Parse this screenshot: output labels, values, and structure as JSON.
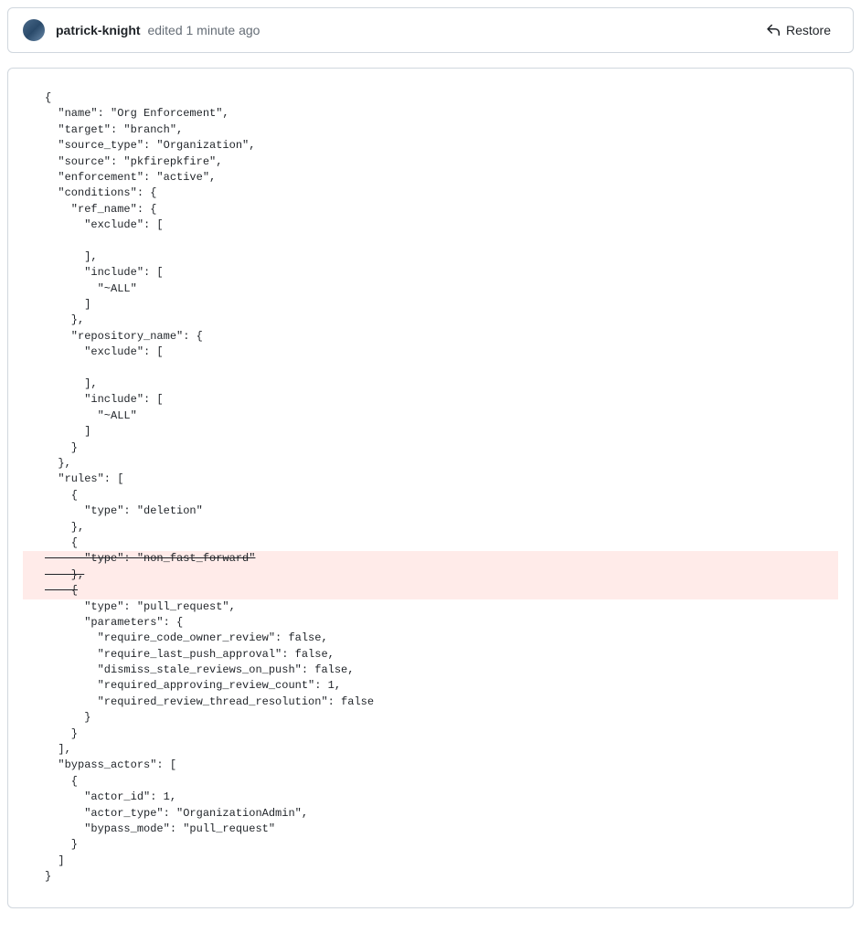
{
  "header": {
    "username": "patrick-knight",
    "edit_info": "edited 1 minute ago",
    "restore_label": "Restore"
  },
  "code": {
    "lines": [
      {
        "text": "{",
        "deleted": false
      },
      {
        "text": "  \"name\": \"Org Enforcement\",",
        "deleted": false
      },
      {
        "text": "  \"target\": \"branch\",",
        "deleted": false
      },
      {
        "text": "  \"source_type\": \"Organization\",",
        "deleted": false
      },
      {
        "text": "  \"source\": \"pkfirepkfire\",",
        "deleted": false
      },
      {
        "text": "  \"enforcement\": \"active\",",
        "deleted": false
      },
      {
        "text": "  \"conditions\": {",
        "deleted": false
      },
      {
        "text": "    \"ref_name\": {",
        "deleted": false
      },
      {
        "text": "      \"exclude\": [",
        "deleted": false
      },
      {
        "text": "",
        "deleted": false
      },
      {
        "text": "      ],",
        "deleted": false
      },
      {
        "text": "      \"include\": [",
        "deleted": false
      },
      {
        "text": "        \"~ALL\"",
        "deleted": false
      },
      {
        "text": "      ]",
        "deleted": false
      },
      {
        "text": "    },",
        "deleted": false
      },
      {
        "text": "    \"repository_name\": {",
        "deleted": false
      },
      {
        "text": "      \"exclude\": [",
        "deleted": false
      },
      {
        "text": "",
        "deleted": false
      },
      {
        "text": "      ],",
        "deleted": false
      },
      {
        "text": "      \"include\": [",
        "deleted": false
      },
      {
        "text": "        \"~ALL\"",
        "deleted": false
      },
      {
        "text": "      ]",
        "deleted": false
      },
      {
        "text": "    }",
        "deleted": false
      },
      {
        "text": "  },",
        "deleted": false
      },
      {
        "text": "  \"rules\": [",
        "deleted": false
      },
      {
        "text": "    {",
        "deleted": false
      },
      {
        "text": "      \"type\": \"deletion\"",
        "deleted": false
      },
      {
        "text": "    },",
        "deleted": false
      },
      {
        "text": "    {",
        "deleted": false
      },
      {
        "text": "      \"type\": \"non_fast_forward\"",
        "deleted": true
      },
      {
        "text": "    },",
        "deleted": true
      },
      {
        "text": "    {",
        "deleted": true
      },
      {
        "text": "      \"type\": \"pull_request\",",
        "deleted": false
      },
      {
        "text": "      \"parameters\": {",
        "deleted": false
      },
      {
        "text": "        \"require_code_owner_review\": false,",
        "deleted": false
      },
      {
        "text": "        \"require_last_push_approval\": false,",
        "deleted": false
      },
      {
        "text": "        \"dismiss_stale_reviews_on_push\": false,",
        "deleted": false
      },
      {
        "text": "        \"required_approving_review_count\": 1,",
        "deleted": false
      },
      {
        "text": "        \"required_review_thread_resolution\": false",
        "deleted": false
      },
      {
        "text": "      }",
        "deleted": false
      },
      {
        "text": "    }",
        "deleted": false
      },
      {
        "text": "  ],",
        "deleted": false
      },
      {
        "text": "  \"bypass_actors\": [",
        "deleted": false
      },
      {
        "text": "    {",
        "deleted": false
      },
      {
        "text": "      \"actor_id\": 1,",
        "deleted": false
      },
      {
        "text": "      \"actor_type\": \"OrganizationAdmin\",",
        "deleted": false
      },
      {
        "text": "      \"bypass_mode\": \"pull_request\"",
        "deleted": false
      },
      {
        "text": "    }",
        "deleted": false
      },
      {
        "text": "  ]",
        "deleted": false
      },
      {
        "text": "}",
        "deleted": false
      }
    ]
  }
}
